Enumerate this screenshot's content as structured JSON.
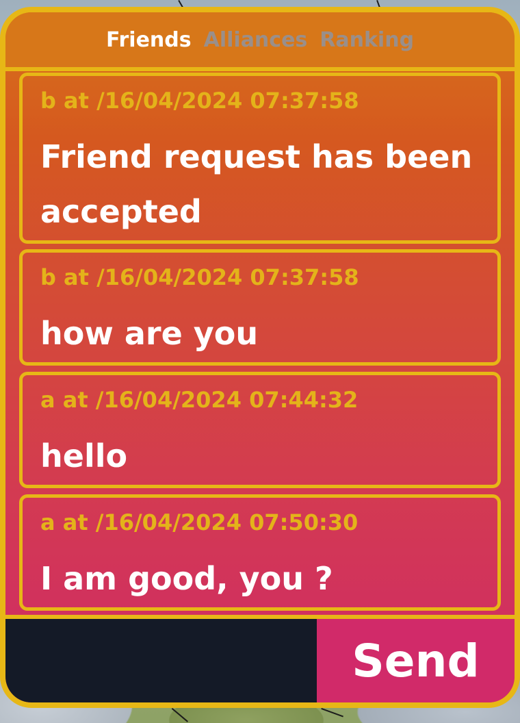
{
  "tabs": [
    {
      "label": "Friends",
      "active": true
    },
    {
      "label": "Alliances",
      "active": false
    },
    {
      "label": "Ranking",
      "active": false
    }
  ],
  "messages": [
    {
      "meta": "b at /16/04/2024 07:37:58",
      "text": "Friend request has been accepted"
    },
    {
      "meta": "b at /16/04/2024 07:37:58",
      "text": "how are you"
    },
    {
      "meta": "a at /16/04/2024 07:44:32",
      "text": "hello"
    },
    {
      "meta": "a at /16/04/2024 07:50:30",
      "text": "I am good, you ?"
    }
  ],
  "composer": {
    "input_value": "",
    "send_label": "Send"
  },
  "colors": {
    "border": "#e7b716",
    "tab_bar": "#d77719",
    "meta_text": "#e4b31a",
    "input_bg": "#141a27",
    "send_bg": "#d12a69"
  }
}
